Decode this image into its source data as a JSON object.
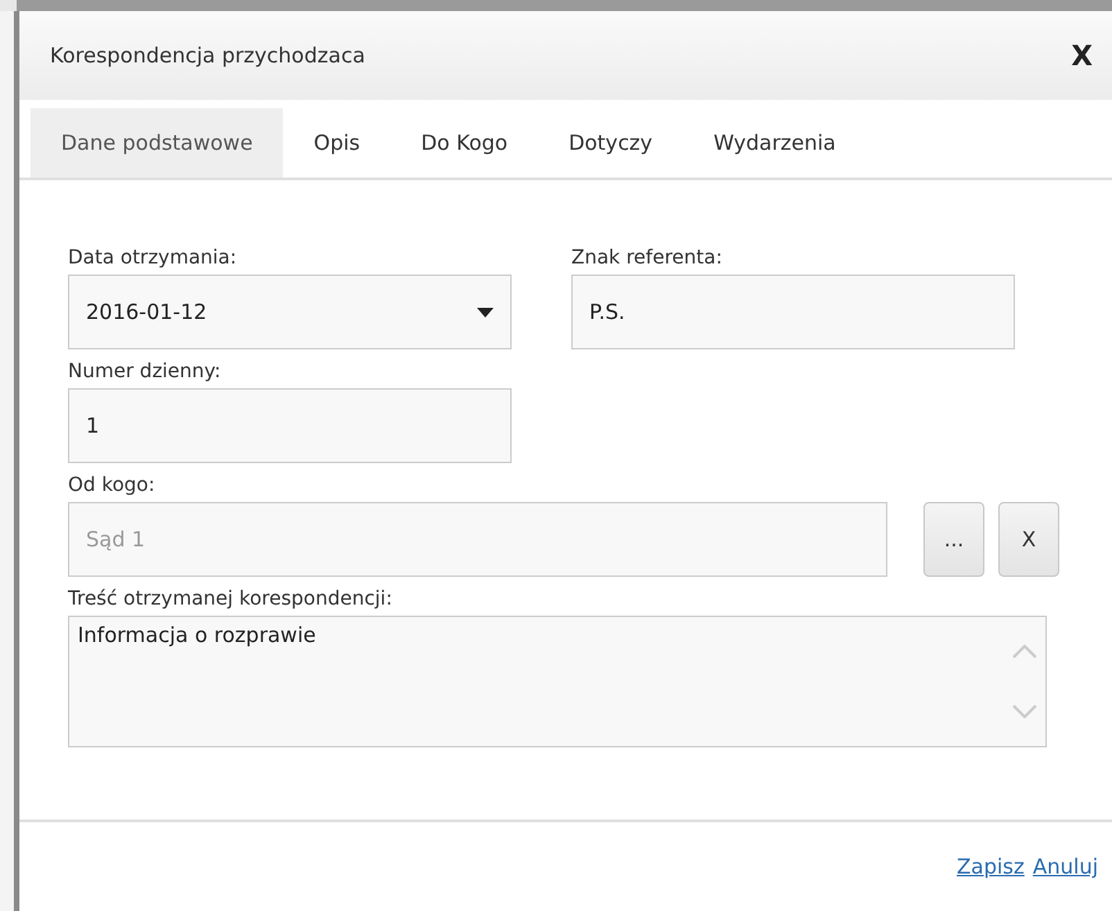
{
  "dialog": {
    "title": "Korespondencja przychodzaca",
    "close": "X"
  },
  "tabs": [
    {
      "label": "Dane podstawowe",
      "selected": true
    },
    {
      "label": "Opis",
      "selected": false
    },
    {
      "label": "Do Kogo",
      "selected": false
    },
    {
      "label": "Dotyczy",
      "selected": false
    },
    {
      "label": "Wydarzenia",
      "selected": false
    }
  ],
  "fields": {
    "date": {
      "label": "Data otrzymania:",
      "value": "2016-01-12"
    },
    "referent": {
      "label": "Znak referenta:",
      "value": "P.S."
    },
    "number": {
      "label": "Numer dzienny:",
      "value": "1"
    },
    "from": {
      "label": "Od kogo:",
      "value": "Sąd 1",
      "disabled": true,
      "buttons": [
        "...",
        "X"
      ]
    },
    "content": {
      "label": "Treść otrzymanej korespondencji:",
      "value": "Informacja o rozprawie"
    }
  },
  "footer": {
    "links": [
      "Zapisz",
      "Anuluj"
    ]
  }
}
